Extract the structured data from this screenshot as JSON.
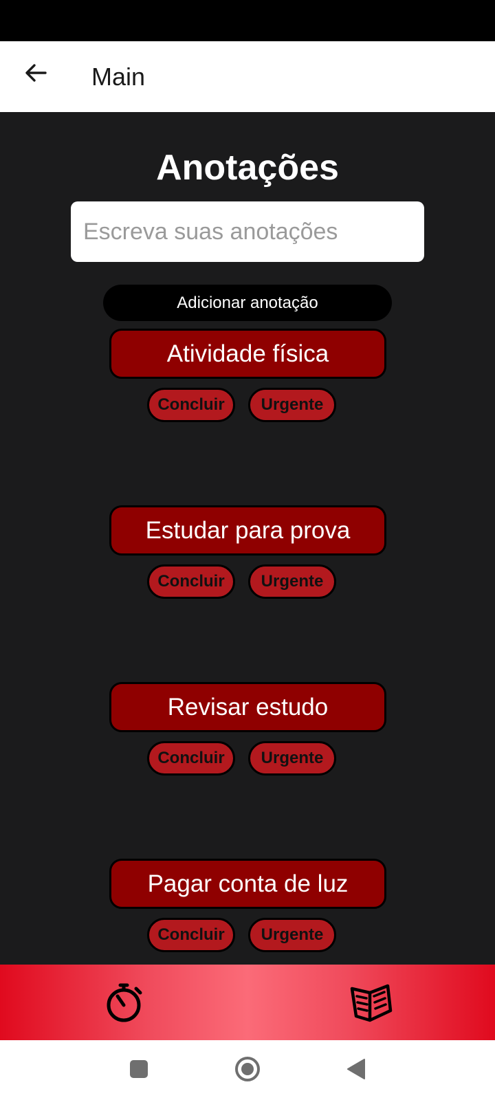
{
  "app_bar": {
    "title": "Main",
    "back_icon": "arrow-left-icon"
  },
  "page": {
    "heading": "Anotações",
    "input_placeholder": "Escreva suas anotações",
    "input_value": "",
    "add_button_label": "Adicionar anotação"
  },
  "notes": [
    {
      "title": "Atividade física",
      "conclude_label": "Concluir",
      "urgent_label": "Urgente"
    },
    {
      "title": "Estudar para prova",
      "conclude_label": "Concluir",
      "urgent_label": "Urgente"
    },
    {
      "title": "Revisar estudo",
      "conclude_label": "Concluir",
      "urgent_label": "Urgente"
    },
    {
      "title": "Pagar conta de luz",
      "conclude_label": "Concluir",
      "urgent_label": "Urgente"
    }
  ],
  "bottom_nav": {
    "items": [
      {
        "icon": "stopwatch-icon"
      },
      {
        "icon": "open-book-icon"
      }
    ]
  },
  "system_nav": {
    "icons": [
      "recents-square-icon",
      "home-circle-icon",
      "back-triangle-icon"
    ]
  },
  "colors": {
    "background": "#1b1b1c",
    "note_title_bg": "#8f0000",
    "action_button_bg": "#b3191e",
    "nav_gradient_edge": "#e00a1e",
    "nav_gradient_center": "#fb6b78"
  }
}
